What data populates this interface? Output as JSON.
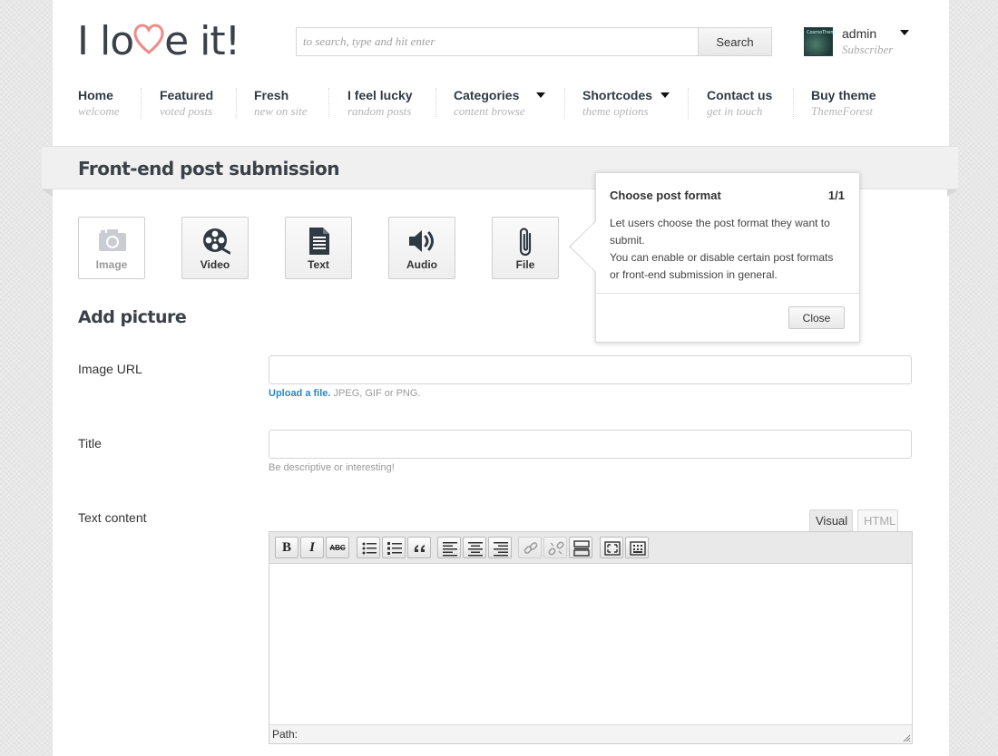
{
  "site": {
    "logo_text_a": "I lo",
    "logo_text_b": "e it!"
  },
  "search": {
    "placeholder": "to search, type and hit enter",
    "button_label": "Search"
  },
  "user": {
    "name": "admin",
    "role": "Subscriber",
    "avatar_text": "CosmoThemes"
  },
  "nav": [
    {
      "label": "Home",
      "sub": "welcome"
    },
    {
      "label": "Featured",
      "sub": "voted posts"
    },
    {
      "label": "Fresh",
      "sub": "new on site"
    },
    {
      "label": "I feel lucky",
      "sub": "random posts"
    },
    {
      "label": "Categories",
      "sub": "content browse"
    },
    {
      "label": "Shortcodes",
      "sub": "theme options"
    },
    {
      "label": "Contact us",
      "sub": "get in touch"
    },
    {
      "label": "Buy theme",
      "sub": "ThemeForest"
    }
  ],
  "page": {
    "title": "Front-end post submission"
  },
  "formats": [
    {
      "label": "Image",
      "icon": "camera-icon",
      "active": true
    },
    {
      "label": "Video",
      "icon": "film-reel-icon",
      "active": false
    },
    {
      "label": "Text",
      "icon": "document-icon",
      "active": false
    },
    {
      "label": "Audio",
      "icon": "speaker-icon",
      "active": false
    },
    {
      "label": "File",
      "icon": "paperclip-icon",
      "active": false
    }
  ],
  "popover": {
    "title": "Choose post format",
    "count": "1/1",
    "line1": "Let users choose the post format they want to",
    "line2": "submit.",
    "line3": "You can enable or disable certain post formats",
    "line4": "or front-end submission in general.",
    "close_label": "Close"
  },
  "form": {
    "section_title": "Add picture",
    "image_url_label": "Image URL",
    "upload_link": "Upload a file.",
    "upload_hint": "JPEG, GIF or PNG.",
    "title_label": "Title",
    "title_hint": "Be descriptive or interesting!",
    "content_label": "Text content"
  },
  "editor": {
    "tab_visual": "Visual",
    "tab_html": "HTML",
    "path_label": "Path:",
    "bold_glyph": "B",
    "italic_glyph": "I",
    "strike_glyph": "ABC"
  },
  "colors": {
    "accent_link": "#2a87c5",
    "logo_heart": "#f08a8a",
    "text_dark": "#3a4148"
  }
}
